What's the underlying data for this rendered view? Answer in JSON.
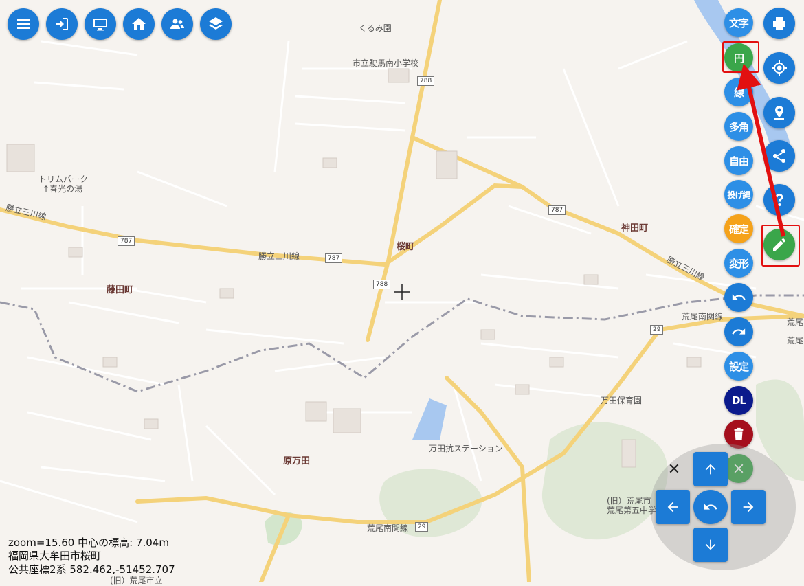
{
  "toolbar_left": {
    "buttons": [
      {
        "name": "menu",
        "icon": "menu-icon"
      },
      {
        "name": "login",
        "icon": "login-icon"
      },
      {
        "name": "screen",
        "icon": "monitor-icon"
      },
      {
        "name": "home",
        "icon": "home-icon"
      },
      {
        "name": "users",
        "icon": "users-icon"
      },
      {
        "name": "layers",
        "icon": "layers-icon"
      }
    ]
  },
  "toolbar_right": {
    "buttons": [
      {
        "name": "print",
        "icon": "printer-icon"
      },
      {
        "name": "locate",
        "icon": "crosshair-icon"
      },
      {
        "name": "place",
        "icon": "map-pin-icon"
      },
      {
        "name": "share",
        "icon": "share-icon"
      },
      {
        "name": "help",
        "icon": "help-icon"
      },
      {
        "name": "draw",
        "icon": "pencil-icon",
        "color": "#3aa64a"
      }
    ]
  },
  "draw_tools": {
    "text": "文字",
    "circle": "円",
    "line": "線",
    "polygon": "多角",
    "freehand": "自由",
    "lasso": "投げ縄",
    "confirm": "確定",
    "transform": "変形",
    "settings": "設定",
    "download": "DL"
  },
  "colors": {
    "blue": "#2d8fe6",
    "green": "#3aa64a",
    "orange": "#f5a21a",
    "navy": "#0b1a8c",
    "red": "#a50f1d",
    "highlight": "#e21010"
  },
  "map": {
    "places": {
      "kurumien": "くるみ園",
      "school": "市立駛馬南小学校",
      "trimpark1": "トリムパーク",
      "trimpark2": "↑春光の湯",
      "sakuramachi": "桜町",
      "kandamachi": "神田町",
      "fujitamachi": "藤田町",
      "haramanda": "原万田",
      "nursery": "万田保育園",
      "station": "万田抗ステーション",
      "arao1": "(旧）荒尾市",
      "arao2": "荒尾第五中学",
      "arao3": "荒尾",
      "arao4": "荒尾",
      "arao5": "(旧）荒尾市立"
    },
    "roads": {
      "katsudachi1": "勝立三川線",
      "katsudachi2": "勝立三川線",
      "katsudachi3": "勝立三川線",
      "araominami1": "荒尾南関線",
      "araominami2": "荒尾南関線"
    },
    "shields": {
      "r788a": "788",
      "r788b": "788",
      "r787a": "787",
      "r787b": "787",
      "r787c": "787",
      "r29a": "29",
      "r29b": "29"
    }
  },
  "info": {
    "zoom_line": "zoom=15.60 中心の標高: 7.04m",
    "address": "福岡県大牟田市桜町",
    "coords": "公共座標2系 582.462,-51452.707"
  }
}
